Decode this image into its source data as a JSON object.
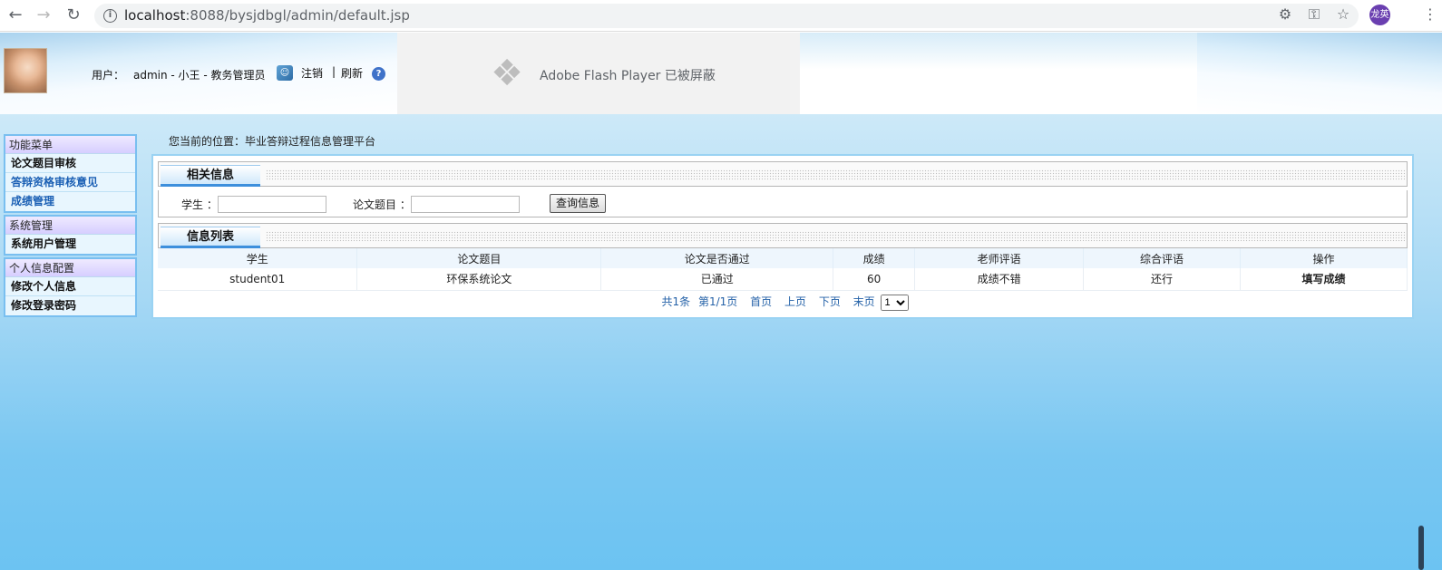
{
  "browser": {
    "url_host": "localhost",
    "url_rest": ":8088/bysjdbgl/admin/default.jsp",
    "profile_initials": "龙英"
  },
  "header": {
    "user_prefix": "用户：",
    "user_info": "admin - 小王 - 教务管理员",
    "logout": "注销",
    "separator": "|",
    "refresh": "刷新",
    "help_glyph": "?",
    "flash_text": "Adobe Flash Player 已被屏蔽"
  },
  "sidebar": {
    "groups": [
      {
        "title": "功能菜单",
        "items": [
          {
            "label": "论文题目审核",
            "style": "black"
          },
          {
            "label": "答辩资格审核意见",
            "style": "link"
          },
          {
            "label": "成绩管理",
            "style": "link"
          }
        ]
      },
      {
        "title": "系统管理",
        "items": [
          {
            "label": "系统用户管理",
            "style": "black"
          }
        ]
      },
      {
        "title": "个人信息配置",
        "items": [
          {
            "label": "修改个人信息",
            "style": "black"
          },
          {
            "label": "修改登录密码",
            "style": "black"
          }
        ]
      }
    ]
  },
  "breadcrumb": "您当前的位置：毕业答辩过程信息管理平台",
  "search_section": {
    "title": "相关信息",
    "student_label": "学生 ：",
    "student_value": "",
    "topic_label": "论文题目 ：",
    "topic_value": "",
    "query_button": "查询信息"
  },
  "list_section": {
    "title": "信息列表",
    "columns": [
      "学生",
      "论文题目",
      "论文是否通过",
      "成绩",
      "老师评语",
      "综合评语",
      "操作"
    ],
    "rows": [
      [
        "student01",
        "环保系统论文",
        "已通过",
        "60",
        "成绩不错",
        "还行",
        "填写成绩"
      ]
    ]
  },
  "pager": {
    "total": "共1条",
    "page": "第1/1页",
    "first": "首页",
    "prev": "上页",
    "next": "下页",
    "last": "末页",
    "select_value": "1"
  },
  "colors": {
    "accent": "#3d8fdc",
    "link": "#2562a8",
    "menu_border": "#79bff0"
  }
}
